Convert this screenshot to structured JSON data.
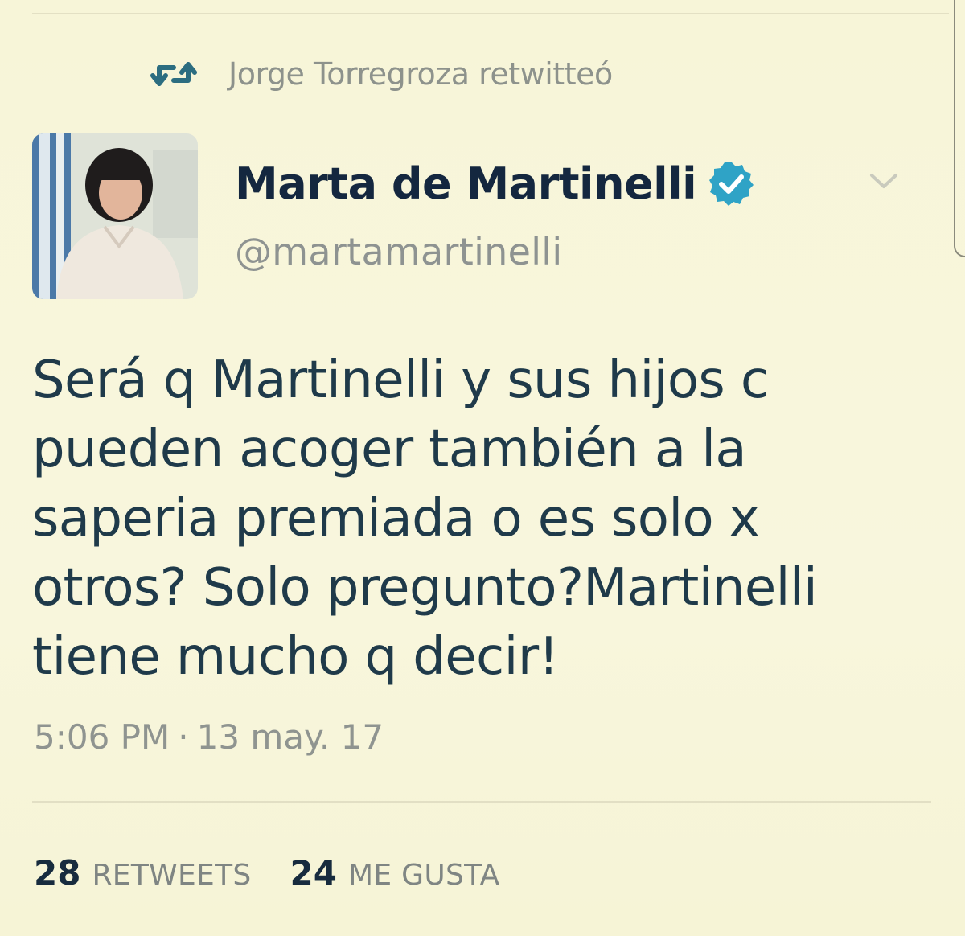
{
  "retweet_context": {
    "icon": "retweet-icon",
    "text": "Jorge Torregroza retwitteó"
  },
  "tweet": {
    "author_name": "Marta de Martinelli",
    "verified_icon": "verified-badge-icon",
    "handle": "@martamartinelli",
    "menu_icon": "chevron-down-icon",
    "text_lines": [
      "Será q Martinelli y sus hijos c",
      "pueden acoger también a la",
      "saperia premiada o es solo x",
      "otros? Solo pregunto?Martinelli",
      "tiene mucho q decir!"
    ],
    "time": "5:06 PM",
    "separator": "·",
    "date": "13 may. 17"
  },
  "stats": {
    "retweets_count": "28",
    "retweets_label": "RETWEETS",
    "likes_count": "24",
    "likes_label": "ME GUSTA"
  },
  "colors": {
    "background": "#f8f6dc",
    "name": "#14273f",
    "body_text": "#1f3a4a",
    "muted": "#8d928c",
    "verified": "#2fa3c6",
    "retweet_icon": "#2c6d80"
  }
}
